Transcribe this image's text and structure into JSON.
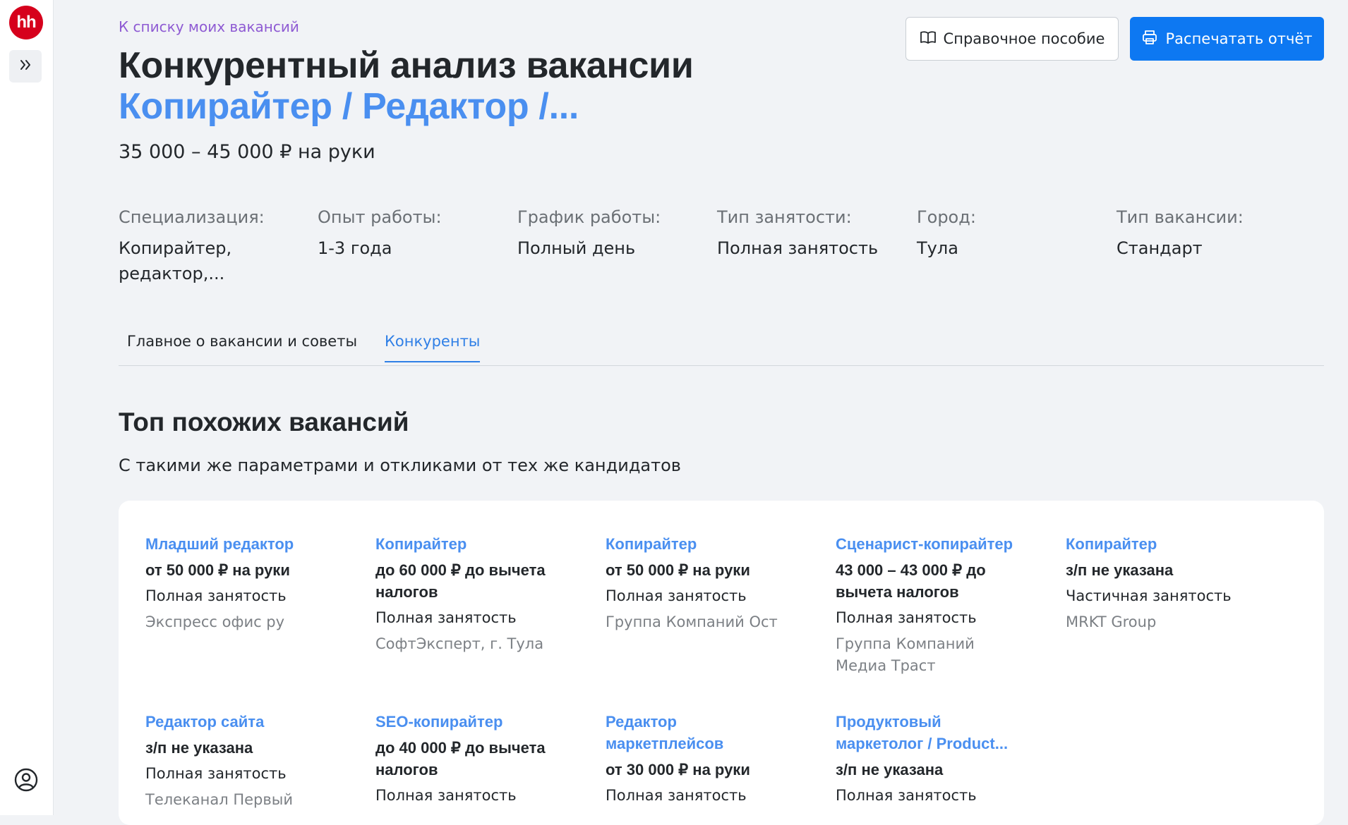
{
  "sidebar": {
    "logo_text": "hh",
    "expand_icon": "chevron-double-right-icon",
    "account_icon": "user-circle-icon"
  },
  "header": {
    "back_link": "К списку моих вакансий",
    "title": "Конкурентный анализ вакансии",
    "vacancy_name": "Копирайтер / Редактор /...",
    "salary": "35 000 – 45 000 ₽ на руки",
    "help_button": "Справочное пособие",
    "print_button": "Распечатать отчёт"
  },
  "params": [
    {
      "label": "Специализация:",
      "value": "Копирайтер, редактор,..."
    },
    {
      "label": "Опыт работы:",
      "value": "1-3 года"
    },
    {
      "label": "График работы:",
      "value": "Полный день"
    },
    {
      "label": "Тип занятости:",
      "value": "Полная занятость"
    },
    {
      "label": "Город:",
      "value": "Тула"
    },
    {
      "label": "Тип вакансии:",
      "value": "Стандарт"
    }
  ],
  "tabs": [
    {
      "label": "Главное о вакансии и советы",
      "active": false
    },
    {
      "label": "Конкуренты",
      "active": true
    }
  ],
  "section": {
    "title": "Топ похожих вакансий",
    "description": "С такими же параметрами и откликами от тех же кандидатов"
  },
  "vacancies": [
    {
      "title": "Младший редактор",
      "salary": "от 50 000 ₽ на руки",
      "employment": "Полная занятость",
      "company": "Экспресс офис ру"
    },
    {
      "title": "Копирайтер",
      "salary": "до 60 000 ₽ до вычета налогов",
      "employment": "Полная занятость",
      "company": "СофтЭксперт, г. Тула"
    },
    {
      "title": "Копирайтер",
      "salary": "от 50 000 ₽ на руки",
      "employment": "Полная занятость",
      "company": "Группа Компаний Ост"
    },
    {
      "title": "Сценарист-копирайтер",
      "salary": "43 000 – 43 000 ₽ до вычета налогов",
      "employment": "Полная занятость",
      "company": "Группа Компаний Медиа Траст"
    },
    {
      "title": "Копирайтер",
      "salary": "з/п не указана",
      "employment": "Частичная занятость",
      "company": "MRKT Group"
    },
    {
      "title": "Редактор сайта",
      "salary": "з/п не указана",
      "employment": "Полная занятость",
      "company": "Телеканал Первый"
    },
    {
      "title": "SEO-копирайтер",
      "salary": "до 40 000 ₽ до вычета налогов",
      "employment": "Полная занятость",
      "company": ""
    },
    {
      "title": "Редактор маркетплейсов",
      "salary": "от 30 000 ₽ на руки",
      "employment": "Полная занятость",
      "company": ""
    },
    {
      "title": "Продуктовый маркетолог / Product...",
      "salary": "з/п не указана",
      "employment": "Полная занятость",
      "company": ""
    }
  ],
  "colors": {
    "accent": "#0d78f2",
    "link": "#4a8ff0",
    "back_link": "#8e5ad3",
    "logo": "#d6001c",
    "page_bg": "#f1f3f6"
  }
}
